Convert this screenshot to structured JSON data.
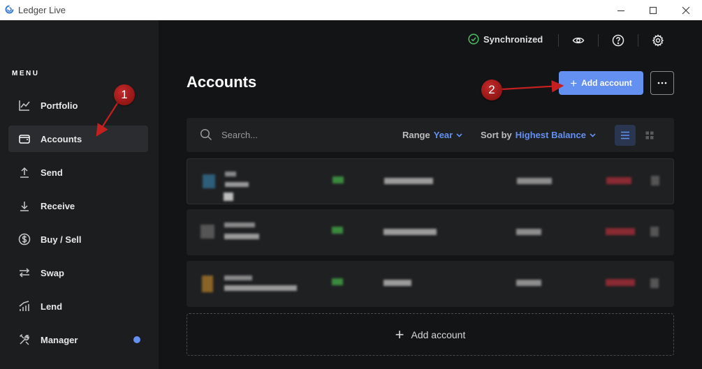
{
  "window": {
    "title": "Ledger Live"
  },
  "sidebar": {
    "menu_title": "MENU",
    "items": [
      {
        "label": "Portfolio",
        "icon": "chart-line-icon",
        "active": false
      },
      {
        "label": "Accounts",
        "icon": "wallet-icon",
        "active": true
      },
      {
        "label": "Send",
        "icon": "arrow-up-icon",
        "active": false
      },
      {
        "label": "Receive",
        "icon": "arrow-down-icon",
        "active": false
      },
      {
        "label": "Buy / Sell",
        "icon": "dollar-circle-icon",
        "active": false
      },
      {
        "label": "Swap",
        "icon": "swap-arrows-icon",
        "active": false
      },
      {
        "label": "Lend",
        "icon": "lend-chart-icon",
        "active": false
      },
      {
        "label": "Manager",
        "icon": "tools-icon",
        "active": false,
        "notification_dot": true
      }
    ]
  },
  "status": {
    "sync_label": "Synchronized",
    "sync_color": "#4ab560"
  },
  "header": {
    "title": "Accounts",
    "add_account_label": "Add account"
  },
  "toolbar": {
    "search_placeholder": "Search...",
    "range_label": "Range",
    "range_value": "Year",
    "sort_label": "Sort by",
    "sort_value": "Highest Balance"
  },
  "footer": {
    "add_account_label": "Add account"
  },
  "annotations": {
    "marker_1": "1",
    "marker_2": "2"
  },
  "colors": {
    "accent": "#6490f1",
    "background": "#131415",
    "sidebar": "#1c1d1f",
    "annotation": "#b01c1c"
  }
}
